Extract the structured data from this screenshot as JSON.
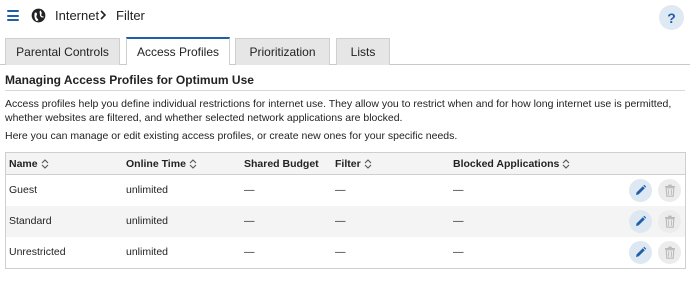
{
  "header": {
    "breadcrumb": [
      "Internet",
      "Filter"
    ],
    "help_label": "?"
  },
  "tabs": [
    {
      "label": "Parental Controls",
      "active": false
    },
    {
      "label": "Access Profiles",
      "active": true
    },
    {
      "label": "Prioritization",
      "active": false
    },
    {
      "label": "Lists",
      "active": false
    }
  ],
  "content": {
    "title": "Managing Access Profiles for Optimum Use",
    "description_1": "Access profiles help you define individual restrictions for internet use. They allow you to restrict when and for how long internet use is permitted, whether websites are filtered, and whether selected network applications are blocked.",
    "description_2": "Here you can manage or edit existing access profiles, or create new ones for your specific needs."
  },
  "table": {
    "columns": [
      "Name",
      "Online Time",
      "Shared Budget",
      "Filter",
      "Blocked Applications"
    ],
    "rows": [
      {
        "name": "Guest",
        "online_time": "unlimited",
        "shared_budget": "—",
        "filter": "—",
        "blocked_apps": "—"
      },
      {
        "name": "Standard",
        "online_time": "unlimited",
        "shared_budget": "—",
        "filter": "—",
        "blocked_apps": "—"
      },
      {
        "name": "Unrestricted",
        "online_time": "unlimited",
        "shared_budget": "—",
        "filter": "—",
        "blocked_apps": "—"
      }
    ]
  },
  "icons": {
    "menu": "hamburger-menu-icon",
    "globe": "globe-icon",
    "separator": "chevron-right-icon",
    "sort": "sort-updown-icon",
    "edit": "pencil-icon",
    "delete": "trash-icon"
  },
  "colors": {
    "accent": "#1f5fa8",
    "edit_button_bg": "#dde8f3",
    "delete_button_bg": "#ececec",
    "row_alt_bg": "#f4f4f4"
  }
}
